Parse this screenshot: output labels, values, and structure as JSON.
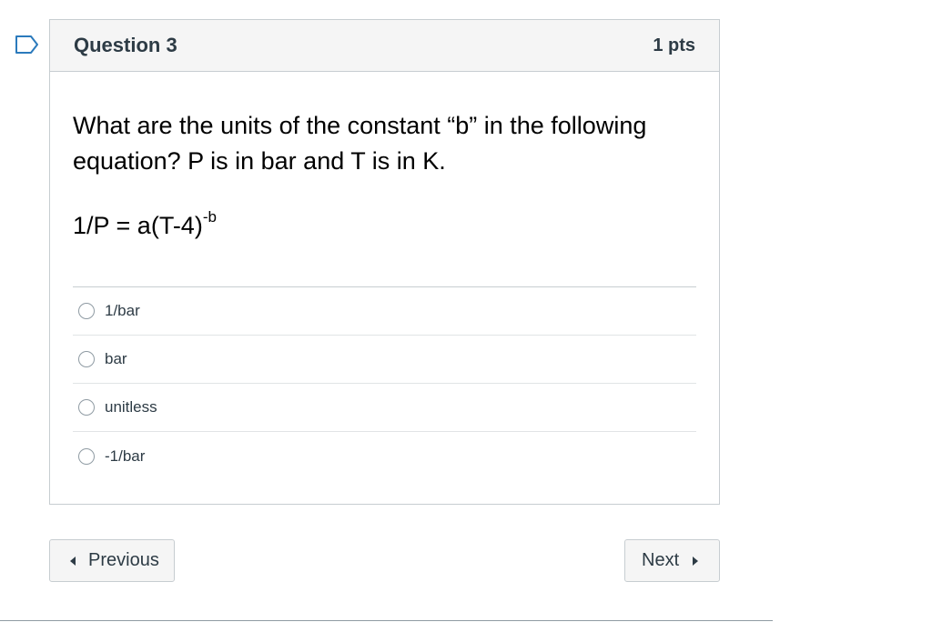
{
  "question": {
    "title": "Question 3",
    "points": "1 pts",
    "text": "What are the units of the constant “b” in the following equation? P is in bar and T is in K.",
    "equation": {
      "base": "1/P = a(T-4)",
      "exponent": "-b"
    },
    "answers": [
      {
        "label": "1/bar"
      },
      {
        "label": "bar"
      },
      {
        "label": "unitless"
      },
      {
        "label": "-1/bar"
      }
    ]
  },
  "nav": {
    "previous_label": "Previous",
    "next_label": "Next"
  },
  "colors": {
    "flag": "#2b7abc",
    "text": "#2d3b45",
    "border": "#c7cdd1",
    "header_bg": "#f5f5f5"
  },
  "icons": {
    "flag": "bookmark-flag-icon",
    "previous": "triangle-left-icon",
    "next": "triangle-right-icon"
  }
}
